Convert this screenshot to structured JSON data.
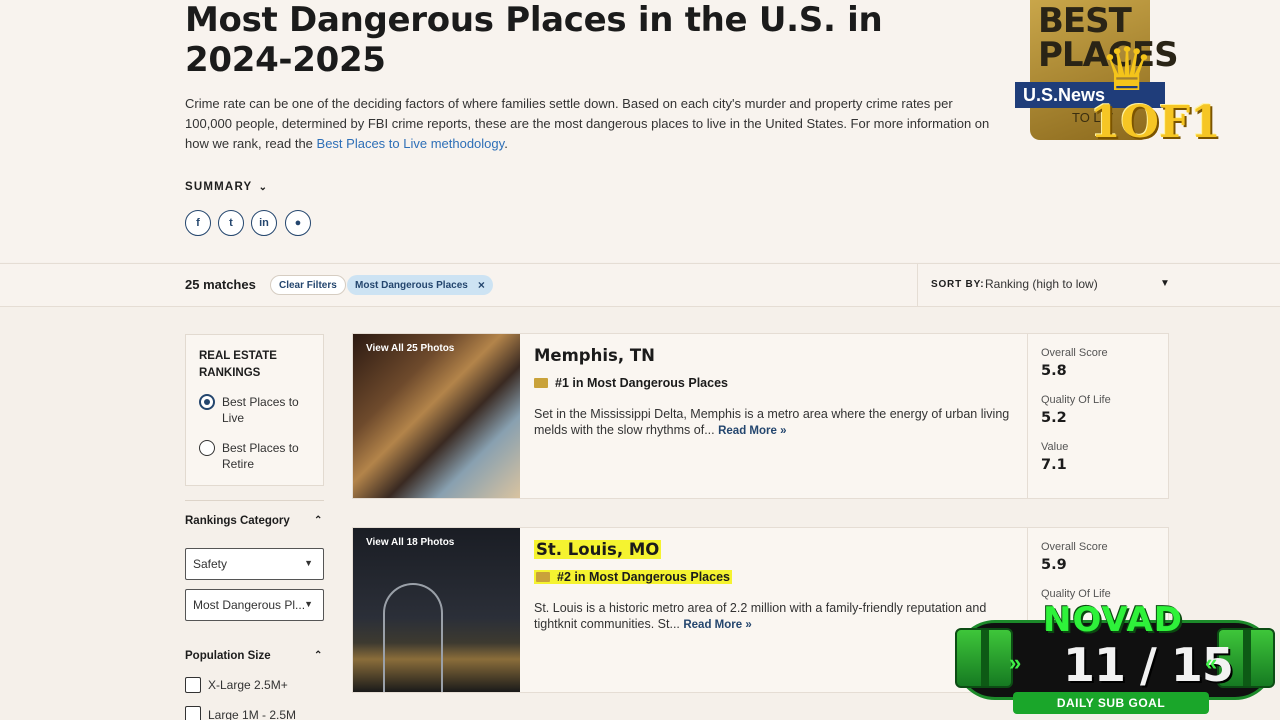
{
  "page": {
    "title": "Most Dangerous Places in the U.S. in 2024-2025",
    "intro_text": "Crime rate can be one of the deciding factors of where families settle down. Based on each city's murder and property crime rates per 100,000 people, determined by FBI crime reports, these are the most dangerous places to live in the United States. For more information on how we rank, read the ",
    "intro_link": "Best Places to Live methodology",
    "intro_end": ".",
    "summary_label": "SUMMARY",
    "social_icons": [
      "facebook-icon",
      "twitter-icon",
      "linkedin-icon",
      "reddit-icon"
    ]
  },
  "badge": {
    "line1": "BEST",
    "line2": "PLACES",
    "ribbon": "U.S.News",
    "sub": "TO LIV",
    "overlay": "1OF1"
  },
  "filters": {
    "matches": "25 matches",
    "clear_label": "Clear Filters",
    "active_filter": "Most Dangerous Places",
    "sort_label": "SORT BY:",
    "sort_value": "Ranking (high to low)"
  },
  "sidebar": {
    "rr_title": "REAL ESTATE RANKINGS",
    "rr_options": [
      {
        "label": "Best Places to Live",
        "selected": true
      },
      {
        "label": "Best Places to Retire",
        "selected": false
      }
    ],
    "category_title": "Rankings Category",
    "category_select": "Safety",
    "category_sub_select": "Most Dangerous Pl...",
    "population_title": "Population Size",
    "population_options": [
      "X-Large 2.5M+",
      "Large 1M - 2.5M"
    ]
  },
  "cards": [
    {
      "photos_label": "View All 25 Photos",
      "name": "Memphis, TN",
      "rank": "#1 in Most Dangerous Places",
      "desc": "Set in the Mississippi Delta, Memphis is a metro area where the energy of urban living melds with the slow rhythms of... ",
      "read_more": "Read More »",
      "scores": [
        {
          "label": "Overall Score",
          "value": "5.8"
        },
        {
          "label": "Quality Of Life",
          "value": "5.2"
        },
        {
          "label": "Value",
          "value": "7.1"
        }
      ]
    },
    {
      "photos_label": "View All 18 Photos",
      "name": "St. Louis, MO",
      "rank": "#2 in Most Dangerous Places",
      "desc": "St. Louis is a historic metro area of 2.2 million with a family-friendly reputation and tightknit communities. St... ",
      "read_more": "Read More »",
      "scores": [
        {
          "label": "Overall Score",
          "value": "5.9"
        },
        {
          "label": "Quality Of Life",
          "value": ""
        }
      ]
    }
  ],
  "overlay": {
    "name": "NOVAD",
    "count": "11 / 15",
    "goal": "DAILY SUB GOAL",
    "arrows": "»"
  }
}
